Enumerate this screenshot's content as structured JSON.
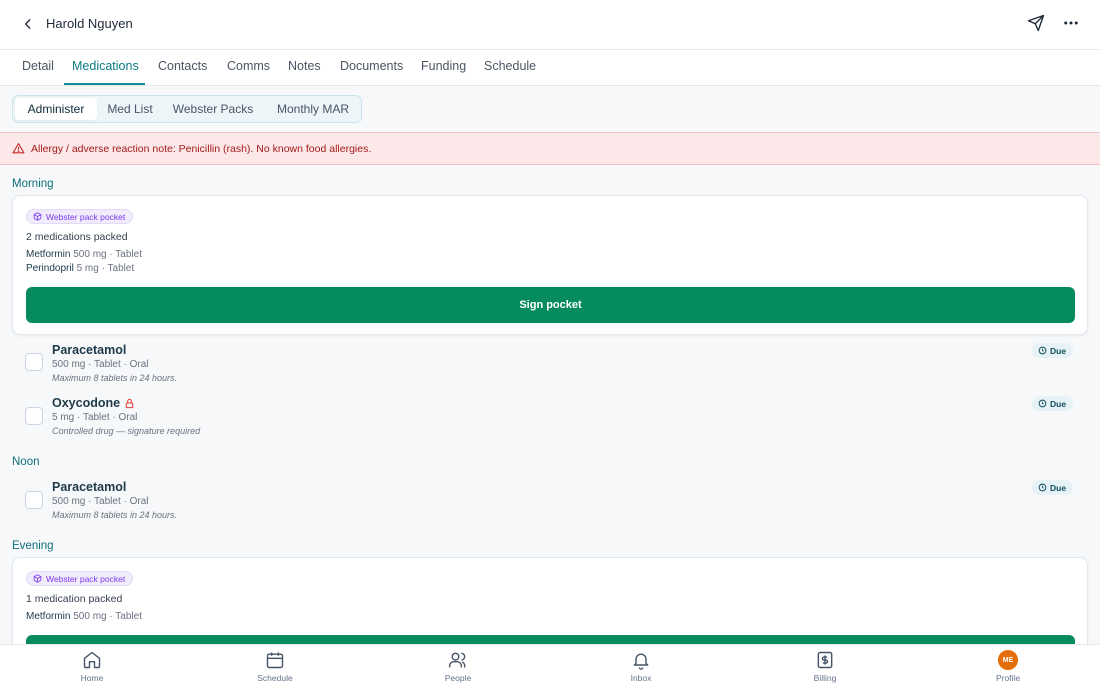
{
  "header": {
    "title": "Harold Nguyen",
    "back_icon": "chevron-left-icon",
    "send_icon": "send-icon",
    "more_icon": "more-horizontal-icon"
  },
  "tabs": [
    {
      "label": "Detail"
    },
    {
      "label": "Medications",
      "active": true
    },
    {
      "label": "Contacts"
    },
    {
      "label": "Comms"
    },
    {
      "label": "Notes"
    },
    {
      "label": "Documents"
    },
    {
      "label": "Funding"
    },
    {
      "label": "Schedule"
    }
  ],
  "subtabs": [
    {
      "label": "Administer",
      "active": true
    },
    {
      "label": "Med List"
    },
    {
      "label": "Webster Packs"
    },
    {
      "label": "Monthly MAR"
    }
  ],
  "alert": {
    "text": "Allergy / adverse reaction note: Penicillin (rash). No known food allergies.",
    "icon": "warning-triangle-icon"
  },
  "sections": {
    "morning": {
      "label": "Morning",
      "pack": {
        "pill": "Webster pack pocket",
        "packed": "2 medications packed",
        "items": [
          {
            "name": "Metformin",
            "detail": "500 mg · Tablet"
          },
          {
            "name": "Perindopril",
            "detail": "5 mg · Tablet"
          }
        ],
        "button": "Sign pocket"
      },
      "meds": [
        {
          "name": "Paracetamol",
          "dose": "500 mg · Tablet · Oral",
          "note": "Maximum 8 tablets in 24 hours.",
          "badge": "Due"
        },
        {
          "name": "Oxycodone",
          "dose": "5 mg · Tablet · Oral",
          "note": "Controlled drug — signature required",
          "badge": "Due",
          "locked": true
        }
      ]
    },
    "noon": {
      "label": "Noon",
      "meds": [
        {
          "name": "Paracetamol",
          "dose": "500 mg · Tablet · Oral",
          "note": "Maximum 8 tablets in 24 hours.",
          "badge": "Due"
        }
      ]
    },
    "evening": {
      "label": "Evening",
      "pack": {
        "pill": "Webster pack pocket",
        "packed": "1 medication packed",
        "items": [
          {
            "name": "Metformin",
            "detail": "500 mg · Tablet"
          }
        ]
      }
    }
  },
  "bottom_nav": [
    {
      "label": "Home",
      "icon": "home-icon"
    },
    {
      "label": "Schedule",
      "icon": "calendar-icon"
    },
    {
      "label": "People",
      "icon": "people-icon"
    },
    {
      "label": "Inbox",
      "icon": "bell-icon"
    },
    {
      "label": "Billing",
      "icon": "billing-icon"
    },
    {
      "label": "Profile",
      "avatar_initials": "ME"
    }
  ],
  "colors": {
    "accent": "#0d8f9a",
    "primary_button": "#068a5f",
    "alert_bg": "#fce8e8",
    "pill_purple": "#7c3aed",
    "avatar": "#e36d0b"
  }
}
